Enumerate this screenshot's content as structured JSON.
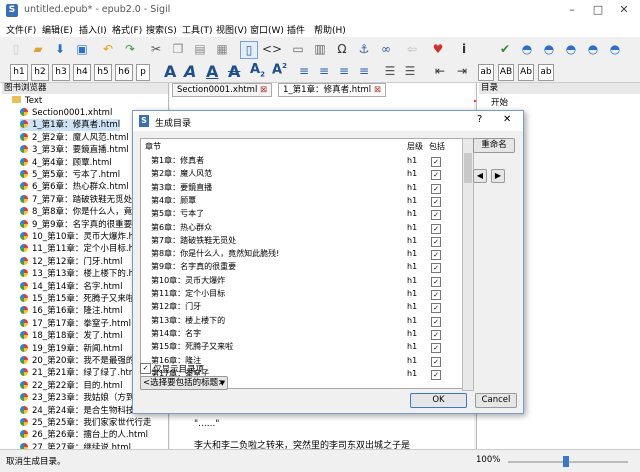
{
  "window": {
    "title": "untitled.epub* - epub2.0 - Sigil"
  },
  "menu": [
    "文件(F)",
    "编辑(E)",
    "插入(I)",
    "格式(F)",
    "搜索(S)",
    "工具(T)",
    "视图(V)",
    "窗口(W)",
    "插件",
    "帮助(H)"
  ],
  "heading_buttons": [
    "h1",
    "h2",
    "h3",
    "h4",
    "h5",
    "h6",
    "p"
  ],
  "case_buttons": [
    "ab",
    "AB",
    "Ab",
    "ab"
  ],
  "book_browser": {
    "title": "图书浏览器",
    "root": "Text",
    "items": [
      "Section0001.xhtml",
      "1_第1章：修真者.html",
      "2_第2章：魔人风范.html",
      "3_第3章：要鏡直播.html",
      "4_第4章：顾覃.html",
      "5_第5章：亏本了.html",
      "6_第6章：热心群众.html",
      "7_第7章：踏破铁鞋无觅处.ht",
      "8_第8章：你是什么人，竟然知",
      "9_第9章：名字真的很重要.htm",
      "10_第10章：灵币大爆炸.htm",
      "11_第11章：定个小目标.htm",
      "12_第12章：门牙.html",
      "13_第13章：楼上楼下的.html",
      "14_第14章：名字.html",
      "15_第15章：死腾子又来啦.ht",
      "16_第16章：隆注.html",
      "17_第17章：拳窒子.html",
      "18_第18章：发了.html",
      "19_第19章：新闻.html",
      "20_第20章：我不是最强的，",
      "21_第21章：绿了绿了.html",
      "22_第22章：目的.html",
      "23_第23章：我姑娘（方到年",
      "24_第24章：是合生物科技公",
      "25_第25章：我们家家世代行走",
      "26_第26章：擂台上的人.html",
      "27_第27章：继续说.html"
    ]
  },
  "tabs": [
    "Section0001.xhtml",
    "1_第1章：修真者.html"
  ],
  "editor": {
    "text1": "\"......\"",
    "text2": "李大和李二负啦之转来，突然里的李司东双出城之子是"
  },
  "toc_panel": {
    "title": "目录",
    "item": "开始"
  },
  "dialog": {
    "title": "生成目录",
    "help": "?",
    "col_chapter": "章节",
    "col_level": "层级",
    "col_include": "包括",
    "rows": [
      {
        "name": "第1章：修真者",
        "level": "h1"
      },
      {
        "name": "第2章：魔人风范",
        "level": "h1"
      },
      {
        "name": "第3章：要鏡直播",
        "level": "h1"
      },
      {
        "name": "第4章：顾覃",
        "level": "h1"
      },
      {
        "name": "第5章：亏本了",
        "level": "h1"
      },
      {
        "name": "第6章：热心群众",
        "level": "h1"
      },
      {
        "name": "第7章：踏破铁鞋无觅处",
        "level": "h1"
      },
      {
        "name": "第8章：你是什么人，竟然知此脆残!",
        "level": "h1"
      },
      {
        "name": "第9章：名字真的很重要",
        "level": "h1"
      },
      {
        "name": "第10章：灵币大爆炸",
        "level": "h1"
      },
      {
        "name": "第11章：定个小目标",
        "level": "h1"
      },
      {
        "name": "第12章：门牙",
        "level": "h1"
      },
      {
        "name": "第13章：楼上楼下的",
        "level": "h1"
      },
      {
        "name": "第14章：名字",
        "level": "h1"
      },
      {
        "name": "第15章：死腾子又来啦",
        "level": "h1"
      },
      {
        "name": "第16章：隆注",
        "level": "h1"
      },
      {
        "name": "第17章：拳窒子",
        "level": "h1"
      }
    ],
    "rename_label": "重命名",
    "show_toc_label": "仅显示目录项",
    "select_label": "<选择要包括的标题>",
    "ok_label": "OK",
    "cancel_label": "Cancel"
  },
  "status": {
    "text": "取消生成目录。",
    "zoom": "100%"
  }
}
